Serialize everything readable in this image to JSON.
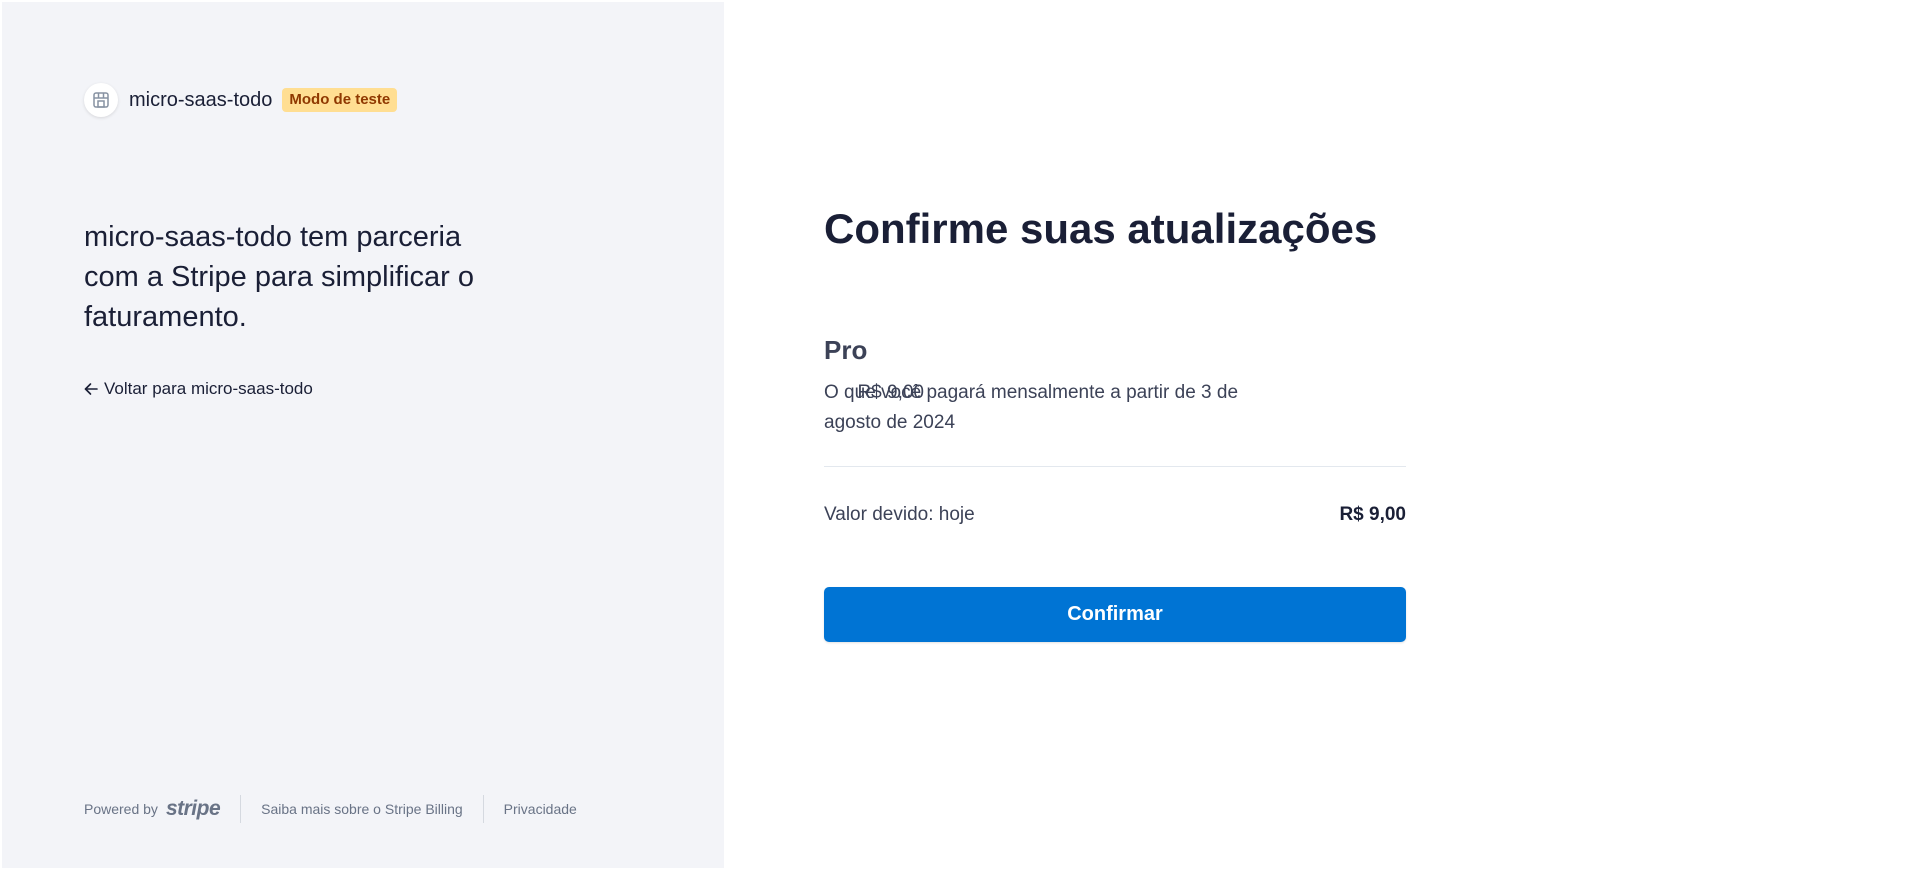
{
  "brand": {
    "name": "micro-saas-todo",
    "badge": "Modo de teste",
    "icon": "storefront-icon"
  },
  "left": {
    "tagline": "micro-saas-todo tem parceria com a Stripe para simplificar o faturamento.",
    "back_link": "Voltar para micro-saas-todo",
    "back_icon": "arrow-left-icon"
  },
  "footer": {
    "powered_by": "Powered by",
    "stripe_logo": "stripe",
    "learn_more": "Saiba mais sobre o Stripe Billing",
    "privacy": "Privacidade"
  },
  "main": {
    "heading": "Confirme suas atualizações",
    "plan": {
      "name": "Pro",
      "description": "O que você pagará mensalmente a partir de 3 de agosto de 2024",
      "price": "R$ 9,00"
    },
    "due": {
      "label": "Valor devido: hoje",
      "amount": "R$ 9,00"
    },
    "confirm_label": "Confirmar"
  },
  "colors": {
    "left_bg": "#f3f4f8",
    "accent": "#0074d4",
    "badge_bg": "#ffde92",
    "badge_text": "#8f3800",
    "text_dark": "#1a1f36"
  }
}
